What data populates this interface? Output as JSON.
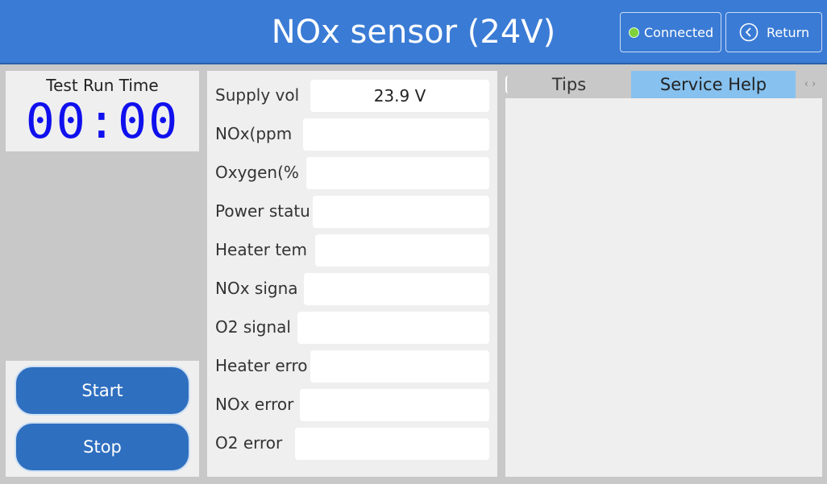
{
  "header": {
    "title": "NOx sensor (24V)",
    "connection_label": "Connected",
    "return_label": "Return",
    "colors": {
      "bar": "#3a7bd5",
      "connected_dot": "#7fd13b"
    }
  },
  "timer": {
    "label": "Test Run Time",
    "value": "00:00",
    "color": "#1010ee"
  },
  "controls": {
    "start_label": "Start",
    "stop_label": "Stop"
  },
  "readings": [
    {
      "label": "Supply vol",
      "value": "23.9 V"
    },
    {
      "label": "NOx(ppm",
      "value": ""
    },
    {
      "label": "Oxygen(%",
      "value": ""
    },
    {
      "label": "Power statu",
      "value": ""
    },
    {
      "label": "Heater tem",
      "value": ""
    },
    {
      "label": "NOx signa",
      "value": ""
    },
    {
      "label": "O2 signal",
      "value": ""
    },
    {
      "label": "Heater erro",
      "value": ""
    },
    {
      "label": "NOx error",
      "value": ""
    },
    {
      "label": "O2 error",
      "value": ""
    }
  ],
  "tabs": {
    "items": [
      "Tips",
      "Service Help"
    ],
    "active": "Service Help",
    "scroll_icons": "‹ ›"
  }
}
